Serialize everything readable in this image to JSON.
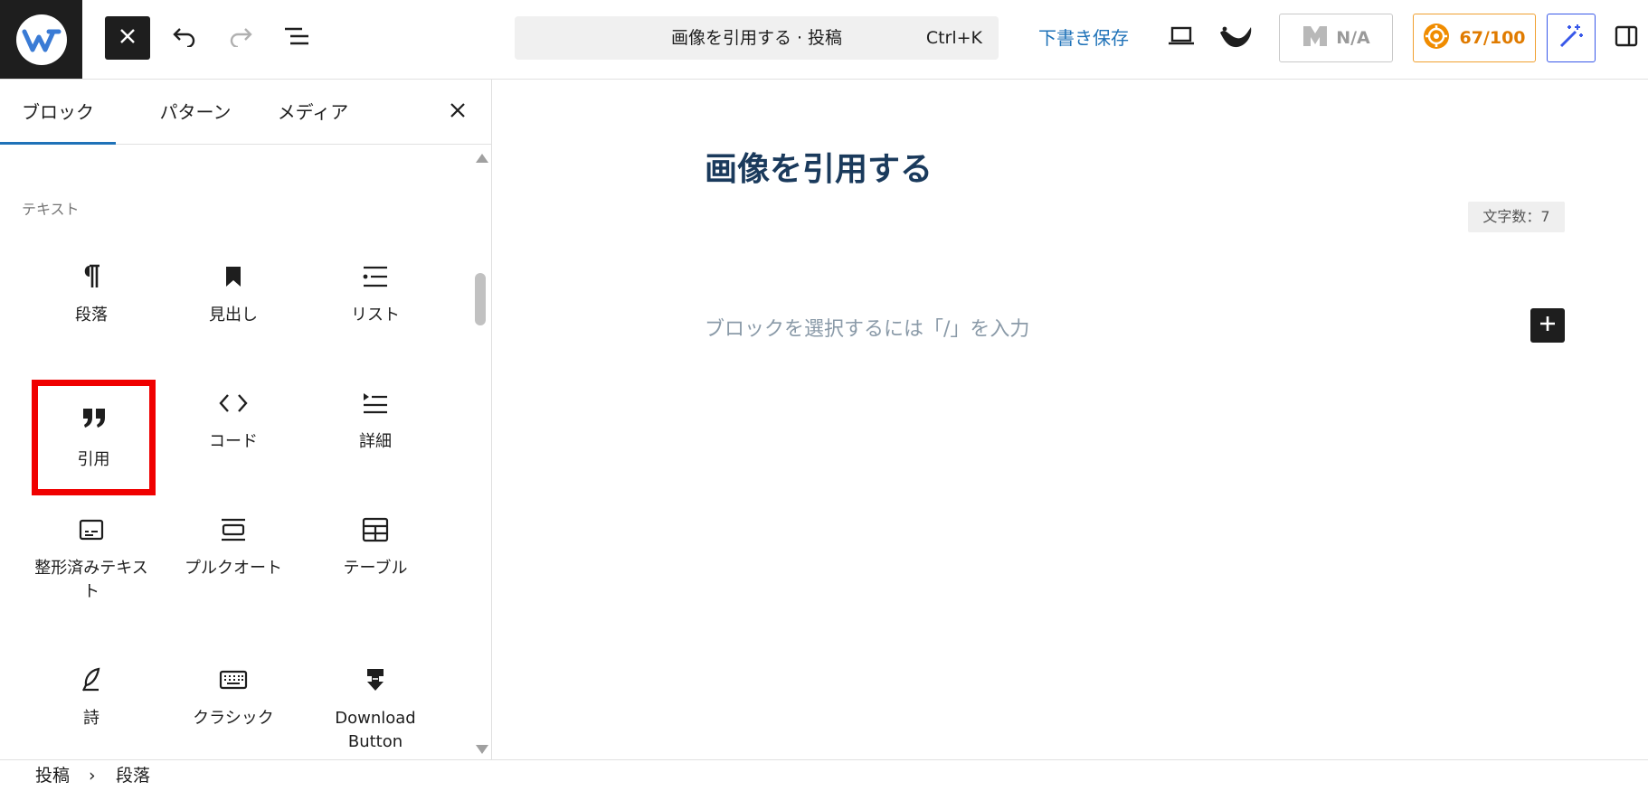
{
  "toolbar": {
    "command_title": "画像を引用する · 投稿",
    "command_shortcut": "Ctrl+K",
    "save_draft": "下書き保存",
    "na_label": "N/A",
    "score_label": "67/100"
  },
  "colors": {
    "accent": "#1f72b8",
    "score": "#e07b00",
    "ai": "#3858e9",
    "highlight": "#f00000",
    "title": "#1a3a5c"
  },
  "inserter": {
    "tabs": [
      "ブロック",
      "パターン",
      "メディア"
    ],
    "section_label": "テキスト",
    "blocks": [
      {
        "label": "段落",
        "icon": "paragraph-icon"
      },
      {
        "label": "見出し",
        "icon": "bookmark-icon"
      },
      {
        "label": "リスト",
        "icon": "list-icon"
      },
      {
        "label": "引用",
        "icon": "quote-icon",
        "selected": true
      },
      {
        "label": "コード",
        "icon": "code-icon"
      },
      {
        "label": "詳細",
        "icon": "details-icon"
      },
      {
        "label": "整形済みテキスト",
        "icon": "preformatted-icon"
      },
      {
        "label": "プルクオート",
        "icon": "pullquote-icon"
      },
      {
        "label": "テーブル",
        "icon": "table-icon"
      },
      {
        "label": "詩",
        "icon": "verse-icon"
      },
      {
        "label": "クラシック",
        "icon": "keyboard-icon"
      },
      {
        "label": "Download Button",
        "icon": "download-icon"
      }
    ]
  },
  "editor": {
    "title": "画像を引用する",
    "char_count": "文字数：7",
    "placeholder": "ブロックを選択するには「/」を入力"
  },
  "breadcrumb": {
    "items": [
      "投稿",
      "段落"
    ],
    "separator": "›"
  }
}
